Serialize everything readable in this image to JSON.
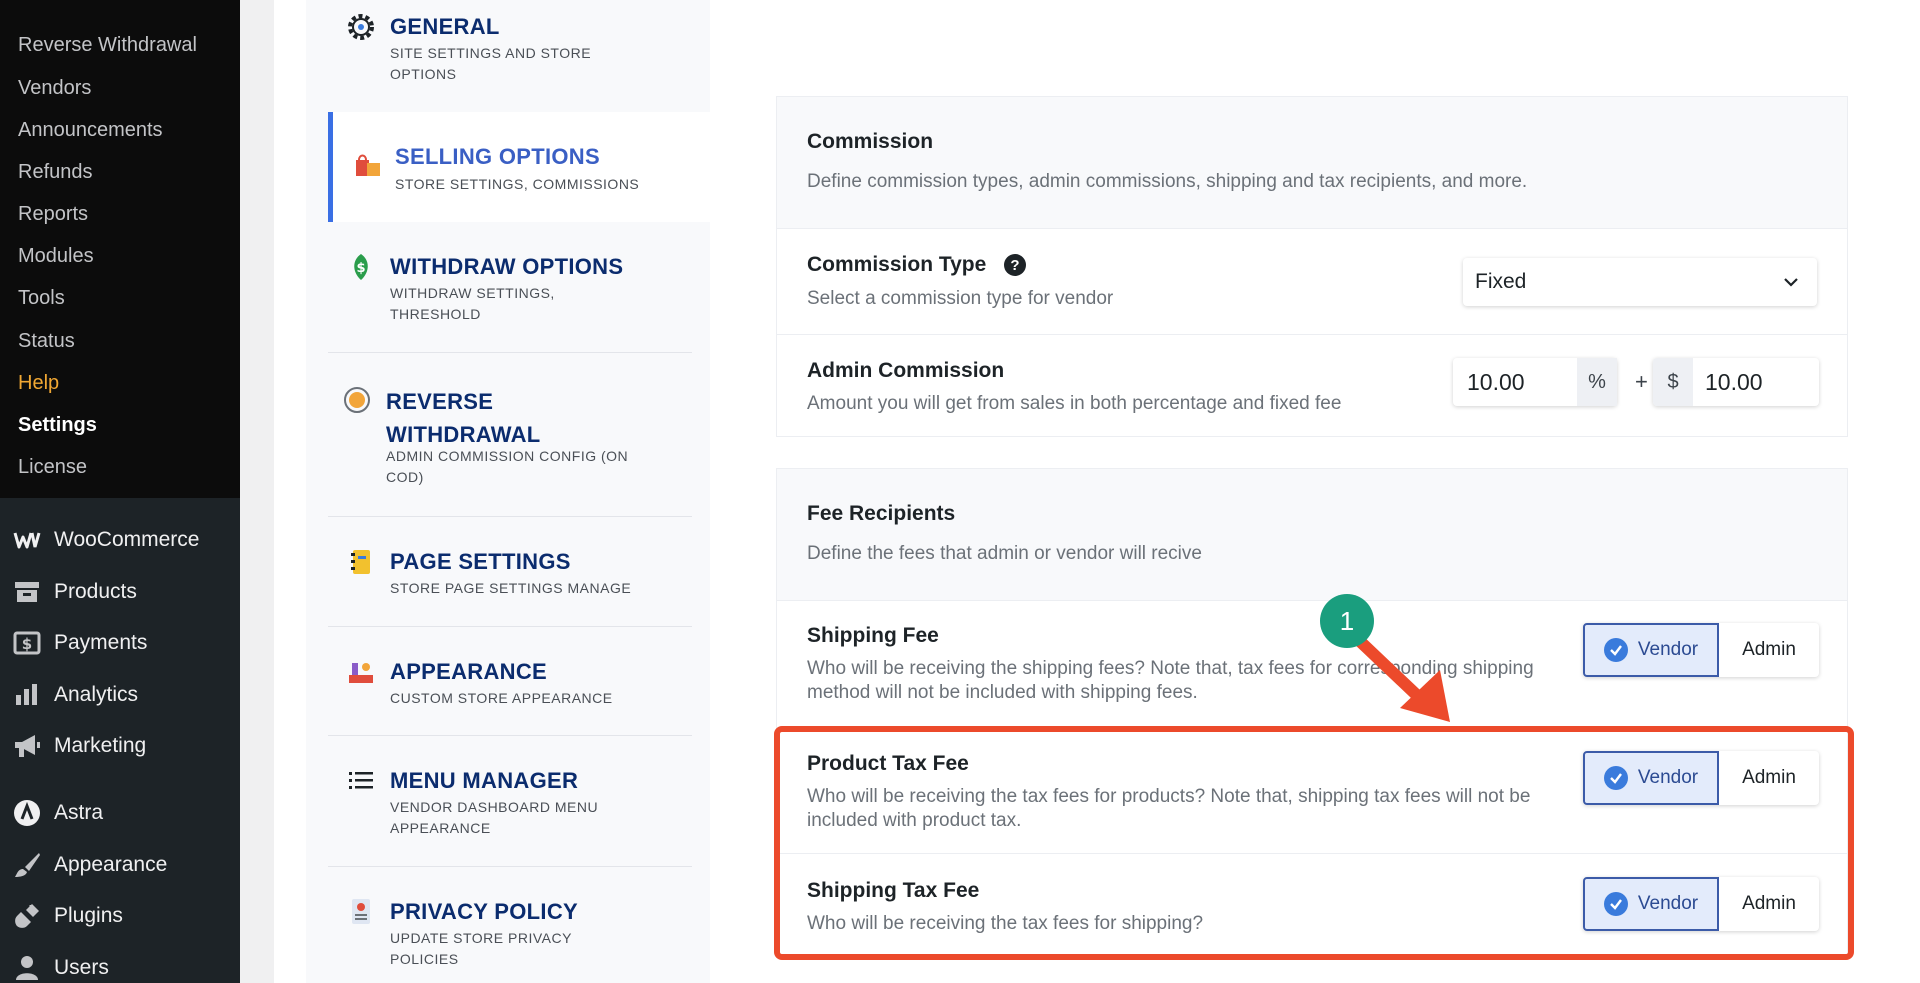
{
  "wp_submenu": {
    "items": [
      {
        "label": "Reverse Withdrawal"
      },
      {
        "label": "Vendors"
      },
      {
        "label": "Announcements"
      },
      {
        "label": "Refunds"
      },
      {
        "label": "Reports"
      },
      {
        "label": "Modules"
      },
      {
        "label": "Tools"
      },
      {
        "label": "Status"
      },
      {
        "label": "Help"
      },
      {
        "label": "Settings"
      },
      {
        "label": "License"
      }
    ]
  },
  "wp_menu": {
    "items": [
      {
        "label": "WooCommerce",
        "icon": "woocommerce-icon"
      },
      {
        "label": "Products",
        "icon": "archive-icon"
      },
      {
        "label": "Payments",
        "icon": "dollar-card-icon"
      },
      {
        "label": "Analytics",
        "icon": "bar-chart-icon"
      },
      {
        "label": "Marketing",
        "icon": "megaphone-icon"
      },
      {
        "label": "Astra",
        "icon": "astra-icon"
      },
      {
        "label": "Appearance",
        "icon": "paintbrush-icon"
      },
      {
        "label": "Plugins",
        "icon": "plug-icon"
      },
      {
        "label": "Users",
        "icon": "user-icon"
      }
    ]
  },
  "settings_nav": {
    "items": [
      {
        "title": "GENERAL",
        "subtitle": "SITE SETTINGS AND STORE OPTIONS",
        "icon": "gear-icon"
      },
      {
        "title": "SELLING OPTIONS",
        "subtitle": "STORE SETTINGS, COMMISSIONS",
        "icon": "shopping-bags-icon"
      },
      {
        "title": "WITHDRAW OPTIONS",
        "subtitle": "WITHDRAW SETTINGS, THRESHOLD",
        "icon": "money-leaf-icon"
      },
      {
        "title": "REVERSE WITHDRAWAL",
        "subtitle": "ADMIN COMMISSION CONFIG (ON COD)",
        "icon": "reverse-coin-icon"
      },
      {
        "title": "PAGE SETTINGS",
        "subtitle": "STORE PAGE SETTINGS MANAGE",
        "icon": "notebook-icon"
      },
      {
        "title": "APPEARANCE",
        "subtitle": "CUSTOM STORE APPEARANCE",
        "icon": "store-appearance-icon"
      },
      {
        "title": "MENU MANAGER",
        "subtitle": "VENDOR DASHBOARD MENU APPEARANCE",
        "icon": "list-icon"
      },
      {
        "title": "PRIVACY POLICY",
        "subtitle": "UPDATE STORE PRIVACY POLICIES",
        "icon": "privacy-document-icon"
      }
    ]
  },
  "commission": {
    "title": "Commission",
    "description": "Define commission types, admin commissions, shipping and tax recipients, and more.",
    "type_label": "Commission Type",
    "type_help": "?",
    "type_description": "Select a commission type for vendor",
    "type_value": "Fixed",
    "admin_label": "Admin Commission",
    "admin_description": "Amount you will get from sales in both percentage and fixed fee",
    "percent_value": "10.00",
    "percent_unit": "%",
    "plus": "+",
    "fixed_unit": "$",
    "fixed_value": "10.00"
  },
  "fee_recipients": {
    "title": "Fee Recipients",
    "description": "Define the fees that admin or vendor will recive",
    "rows": [
      {
        "title": "Shipping Fee",
        "description": "Who will be receiving the shipping fees? Note that, tax fees for corresponding shipping method will not be included with shipping fees.",
        "selected": "Vendor",
        "option_vendor": "Vendor",
        "option_admin": "Admin"
      },
      {
        "title": "Product Tax Fee",
        "description": "Who will be receiving the tax fees for products? Note that, shipping tax fees will not be included with product tax.",
        "selected": "Vendor",
        "option_vendor": "Vendor",
        "option_admin": "Admin"
      },
      {
        "title": "Shipping Tax Fee",
        "description": "Who will be receiving the tax fees for shipping?",
        "selected": "Vendor",
        "option_vendor": "Vendor",
        "option_admin": "Admin"
      }
    ]
  },
  "annotation": {
    "step": "1",
    "color": "#ec4a2b",
    "badge_color": "#1a9e7e"
  }
}
